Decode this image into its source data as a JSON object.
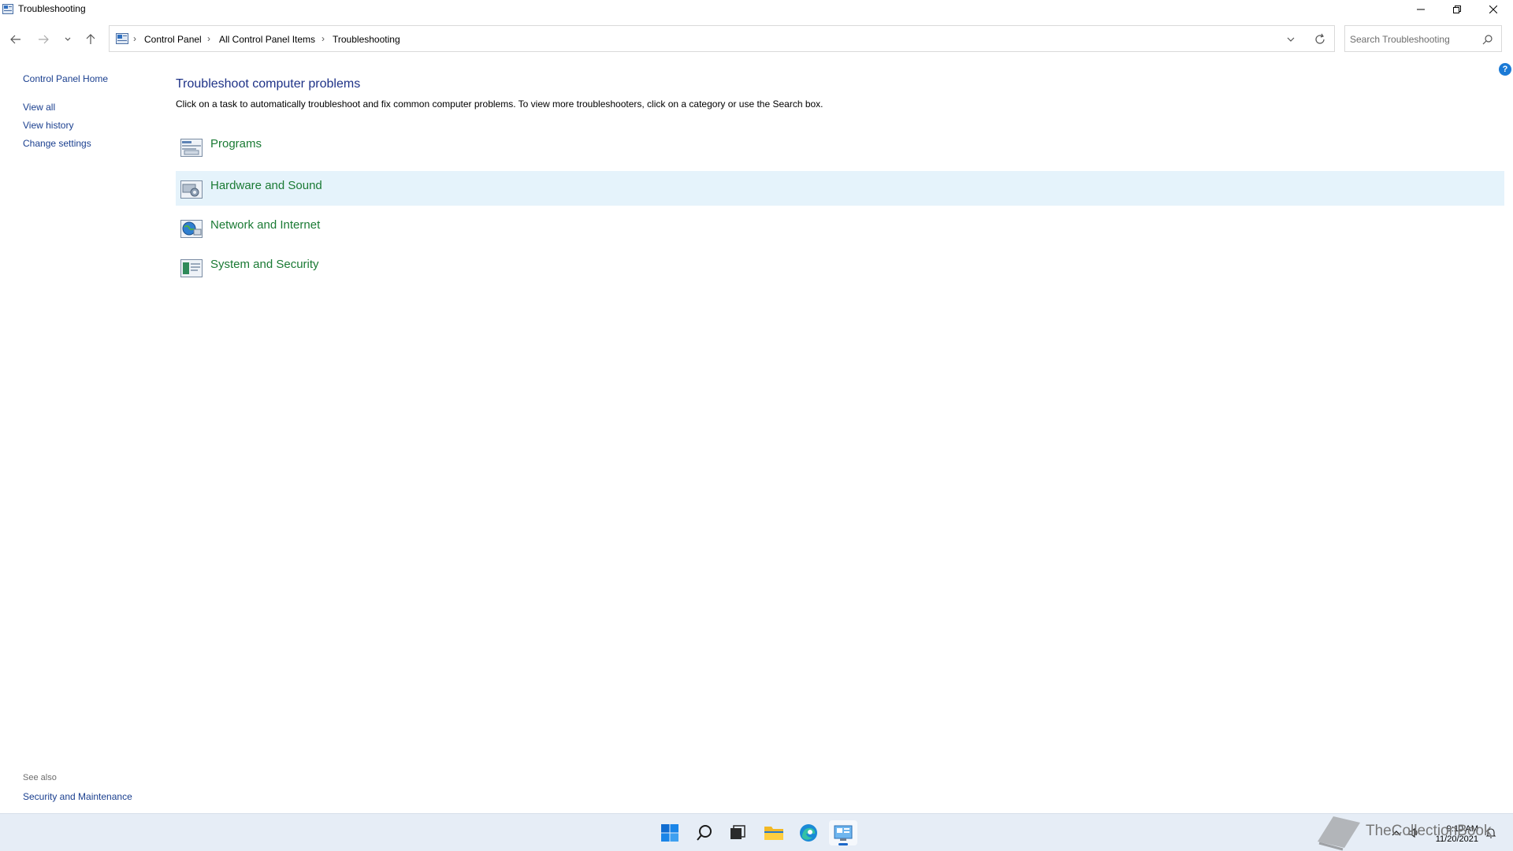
{
  "window": {
    "title": "Troubleshooting"
  },
  "nav": {
    "breadcrumbs": [
      "Control Panel",
      "All Control Panel Items",
      "Troubleshooting"
    ]
  },
  "search": {
    "placeholder": "Search Troubleshooting",
    "value": ""
  },
  "sidebar": {
    "home": "Control Panel Home",
    "links": [
      "View all",
      "View history",
      "Change settings"
    ],
    "see_also_heading": "See also",
    "see_also_links": [
      "Security and Maintenance"
    ]
  },
  "main": {
    "title": "Troubleshoot computer problems",
    "description": "Click on a task to automatically troubleshoot and fix common computer problems. To view more troubleshooters, click on a category or use the Search box.",
    "categories": [
      {
        "label": "Programs",
        "icon": "programs-icon"
      },
      {
        "label": "Hardware and Sound",
        "icon": "hardware-sound-icon"
      },
      {
        "label": "Network and Internet",
        "icon": "network-internet-icon"
      },
      {
        "label": "System and Security",
        "icon": "system-security-icon"
      }
    ]
  },
  "taskbar": {
    "items": [
      "start-icon",
      "search-icon",
      "task-view-icon",
      "file-explorer-icon",
      "edge-icon",
      "control-panel-icon"
    ],
    "time": "9:10 AM",
    "date": "11/20/2021",
    "watermark": "TheCollectionBook"
  },
  "colors": {
    "link": "#1a3f8f",
    "title": "#1e3287",
    "category": "#1a7a34",
    "hover": "#e5f3fb",
    "taskbar": "#e6edf6"
  }
}
